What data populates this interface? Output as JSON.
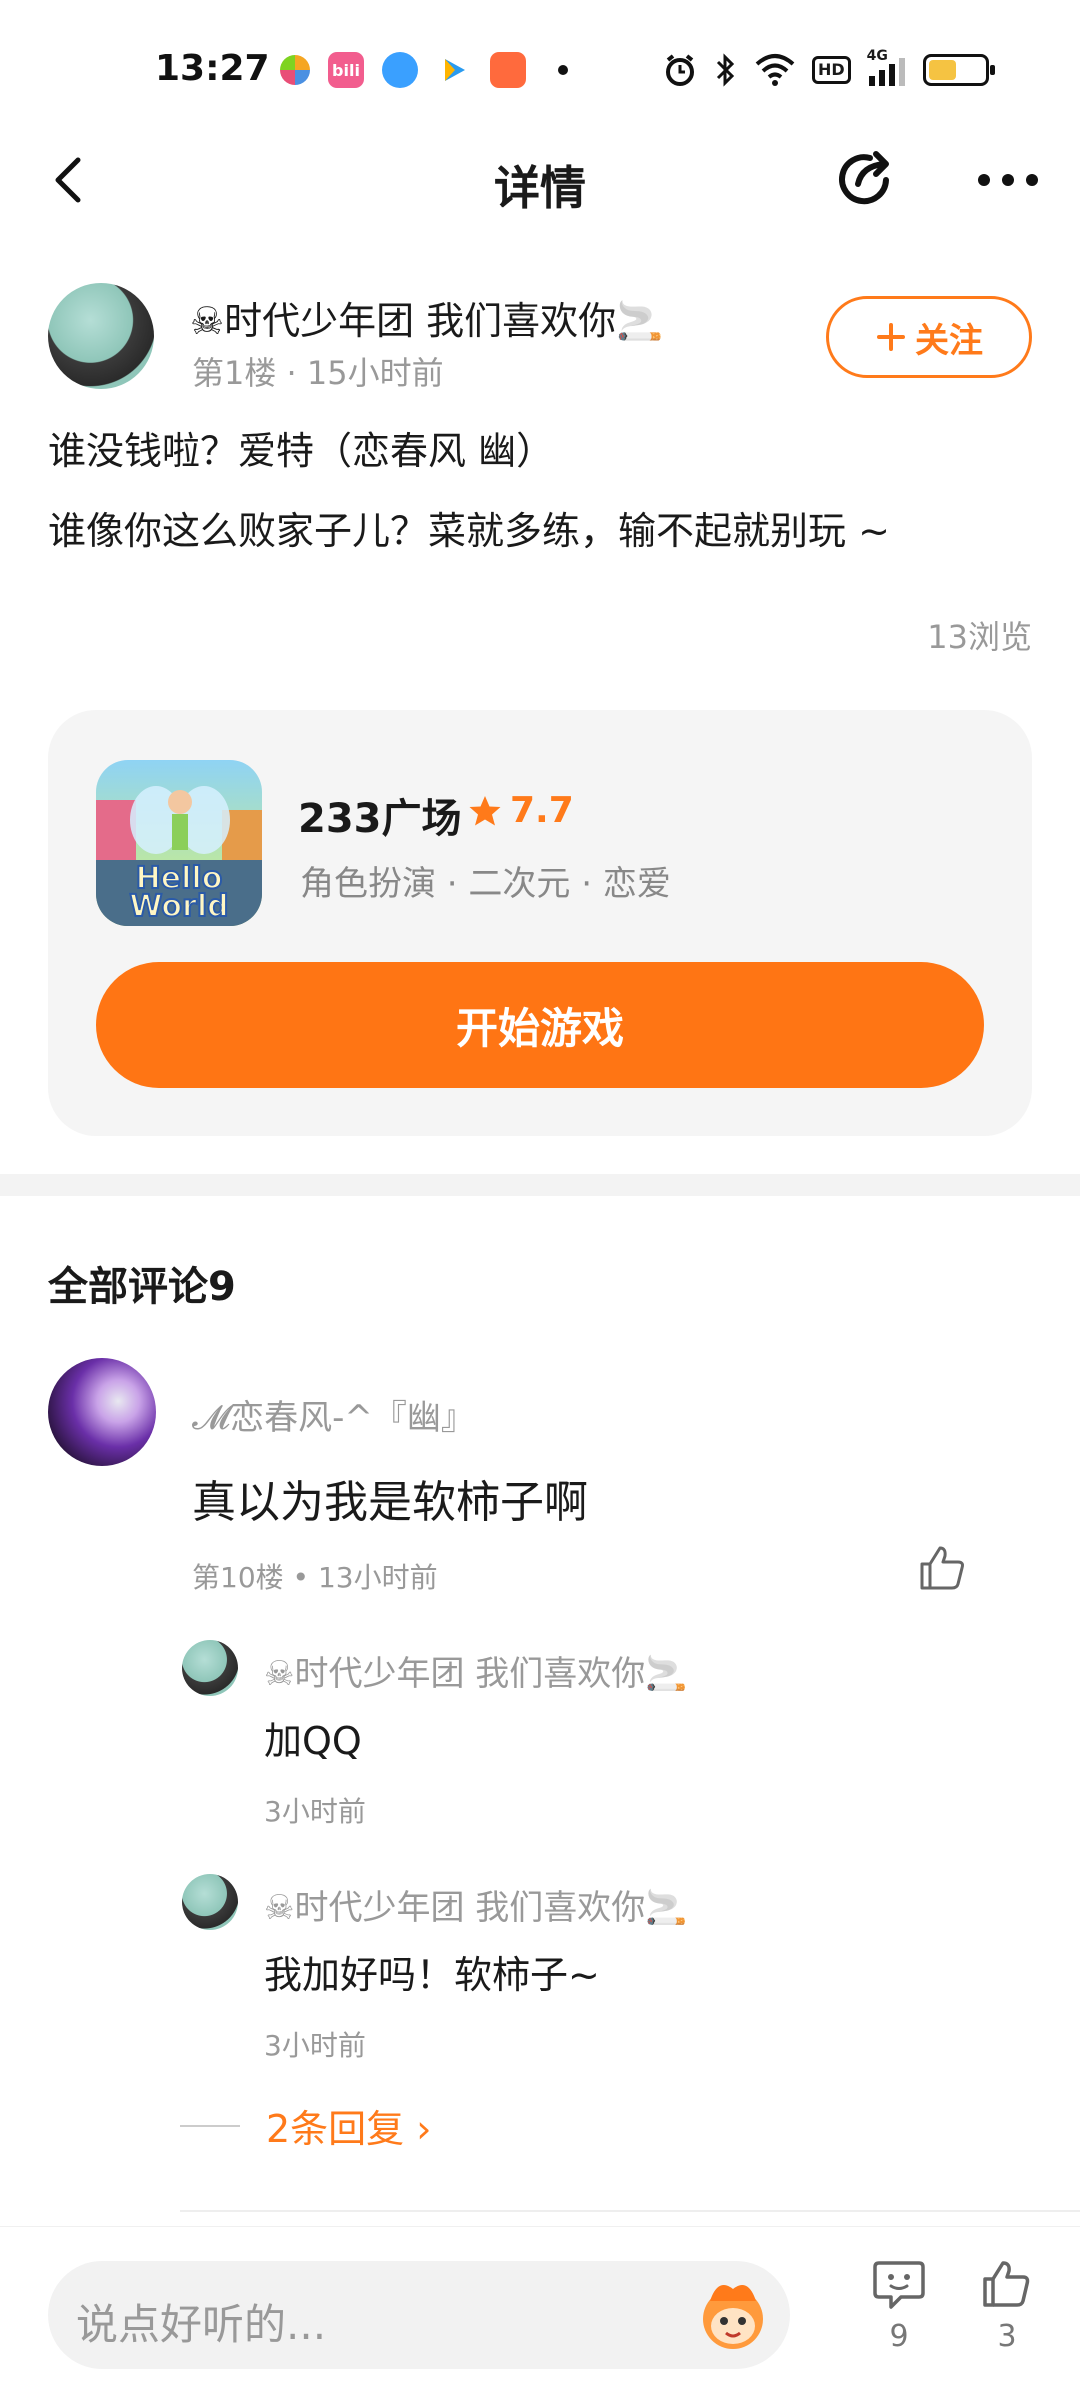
{
  "status_bar": {
    "time": "13:27",
    "apps": [
      "app-icon-1",
      "bilibili-icon",
      "app-icon-3",
      "app-icon-4",
      "app-icon-5"
    ],
    "bilibili_label": "bili",
    "hd": "HD",
    "network": "4G",
    "battery_level": 0.5
  },
  "header": {
    "title": "详情"
  },
  "post": {
    "author": "☠时代少年团 我们喜欢你🚬",
    "meta": "第1楼 · 15小时前",
    "follow_label": "关注",
    "line1": "谁没钱啦？爱特（恋春风 幽）",
    "line2": "谁像你这么败家子儿？菜就多练，输不起就别玩 ~",
    "views": "13浏览"
  },
  "game": {
    "icon_text": "Hello World",
    "name": "233广场",
    "rating": "7.7",
    "tags": "角色扮演 · 二次元 · 恋爱",
    "play_label": "开始游戏"
  },
  "comments": {
    "title": "全部评论9",
    "items": [
      {
        "author": "𝓜恋春风-^『幽』",
        "text": "真以为我是软柿子啊",
        "meta": "第10楼 • 13小时前"
      }
    ],
    "replies": [
      {
        "author": "☠时代少年团 我们喜欢你🚬",
        "text": "加QQ",
        "meta": "3小时前"
      },
      {
        "author": "☠时代少年团 我们喜欢你🚬",
        "text": "我加好吗！软柿子~",
        "meta": "3小时前"
      }
    ],
    "more_replies": "2条回复 ›"
  },
  "bottom_bar": {
    "input_placeholder": "说点好听的...",
    "comment_count": "9",
    "like_count": "3"
  },
  "colors": {
    "accent": "#ff7a1a",
    "card_bg": "#f5f5f5"
  }
}
